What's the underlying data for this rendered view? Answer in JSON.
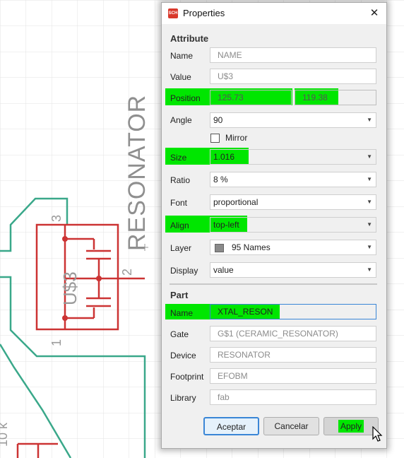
{
  "schematic": {
    "resonator_label": "RESONATOR",
    "part_label": "U$3",
    "pin3": "3",
    "pin2": "2",
    "pin1": "1",
    "corner_text": "10 k"
  },
  "dialog": {
    "title": "Properties",
    "close_glyph": "✕",
    "icon_text": "SCH"
  },
  "attribute": {
    "section": "Attribute",
    "name_label": "Name",
    "name_value": "NAME",
    "value_label": "Value",
    "value_value": "U$3",
    "position_label": "Position",
    "position_x": "125.73",
    "position_y": "119.38",
    "angle_label": "Angle",
    "angle_value": "90",
    "mirror_label": "Mirror",
    "mirror_checked": false,
    "size_label": "Size",
    "size_value": "1.016",
    "ratio_label": "Ratio",
    "ratio_value": "8 %",
    "font_label": "Font",
    "font_value": "proportional",
    "align_label": "Align",
    "align_value": "top-left",
    "layer_label": "Layer",
    "layer_value": "95 Names",
    "display_label": "Display",
    "display_value": "value"
  },
  "part": {
    "section": "Part",
    "name_label": "Name",
    "name_value": "XTAL_RESON",
    "gate_label": "Gate",
    "gate_value": "G$1 (CERAMIC_RESONATOR)",
    "device_label": "Device",
    "device_value": "RESONATOR",
    "footprint_label": "Footprint",
    "footprint_value": "EFOBM",
    "library_label": "Library",
    "library_value": "fab"
  },
  "buttons": {
    "accept": "Aceptar",
    "cancel": "Cancelar",
    "apply": "Apply"
  },
  "colors": {
    "highlight": "#00e600",
    "wire": "#3aa88a",
    "symbol": "#cc3333",
    "grid": "#e3e3e3",
    "layer_swatch": "#8a8a8a"
  },
  "icons": {
    "cursor": "mouse-pointer-icon"
  }
}
